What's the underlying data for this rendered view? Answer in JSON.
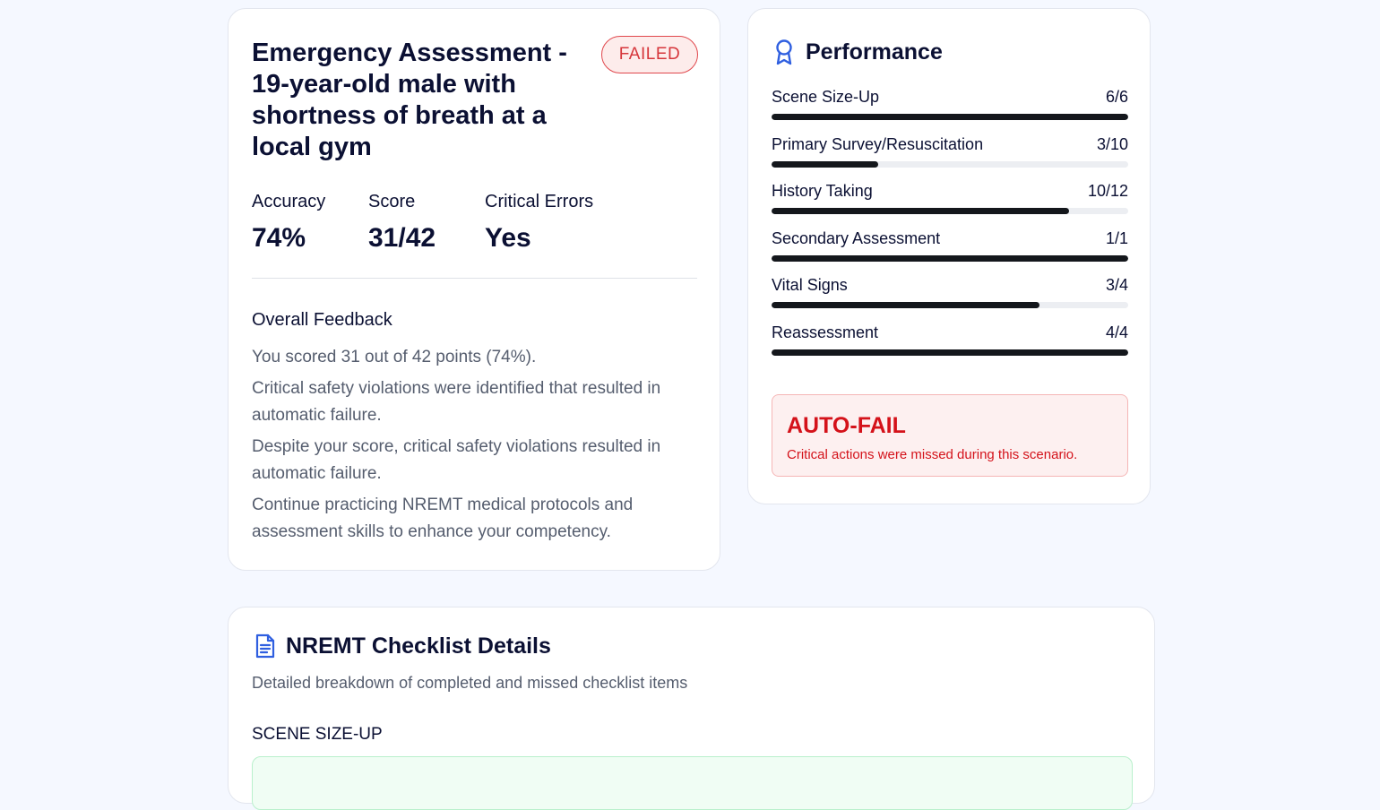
{
  "summary": {
    "title": "Emergency Assessment - 19-year-old male with shortness of breath at a local gym",
    "status_badge": "FAILED",
    "stats": [
      {
        "label": "Accuracy",
        "value": "74%"
      },
      {
        "label": "Score",
        "value": "31/42"
      },
      {
        "label": "Critical Errors",
        "value": "Yes"
      }
    ],
    "feedback_heading": "Overall Feedback",
    "feedback": [
      "You scored 31 out of 42 points (74%).",
      "Critical safety violations were identified that resulted in automatic failure.",
      "Despite your score, critical safety violations resulted in automatic failure.",
      "Continue practicing NREMT medical protocols and assessment skills to enhance your competency."
    ]
  },
  "performance": {
    "heading": "Performance",
    "icon": "award-ribbon-icon",
    "accent": "#2f5fe0",
    "categories": [
      {
        "label": "Scene Size-Up",
        "score": "6/6",
        "fraction": 1.0
      },
      {
        "label": "Primary Survey/Resuscitation",
        "score": "3/10",
        "fraction": 0.3
      },
      {
        "label": "History Taking",
        "score": "10/12",
        "fraction": 0.833
      },
      {
        "label": "Secondary Assessment",
        "score": "1/1",
        "fraction": 1.0
      },
      {
        "label": "Vital Signs",
        "score": "3/4",
        "fraction": 0.75
      },
      {
        "label": "Reassessment",
        "score": "4/4",
        "fraction": 1.0
      }
    ],
    "auto_fail": {
      "heading": "AUTO-FAIL",
      "text": "Critical actions were missed during this scenario."
    }
  },
  "checklist": {
    "heading": "NREMT Checklist Details",
    "icon": "document-icon",
    "subtitle": "Detailed breakdown of completed and missed checklist items",
    "section": "SCENE SIZE-UP"
  }
}
